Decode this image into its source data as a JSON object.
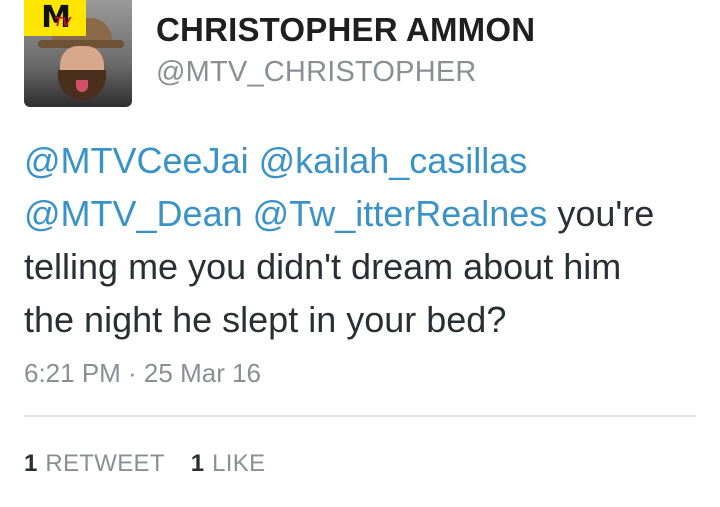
{
  "profile": {
    "display_name": "CHRISTOPHER AMMON",
    "handle": "@MTV_CHRISTOPHER",
    "avatar_badge": "MTV"
  },
  "tweet": {
    "mentions": [
      "@MTVCeeJai",
      "@kailah_casillas",
      "@MTV_Dean",
      "@Tw_itterRealnes"
    ],
    "text_line2_tail": "you're",
    "text_line3": "telling me you didn't dream about him",
    "text_line4": "the night he slept in your bed?",
    "timestamp": "6:21 PM · 25 Mar 16"
  },
  "stats": {
    "retweets_count": "1",
    "retweets_label": "RETWEET",
    "likes_count": "1",
    "likes_label": "LIKE"
  },
  "colors": {
    "mention": "#3a93c8",
    "meta_text": "#8a8f94",
    "badge_yellow": "#ffe600"
  }
}
